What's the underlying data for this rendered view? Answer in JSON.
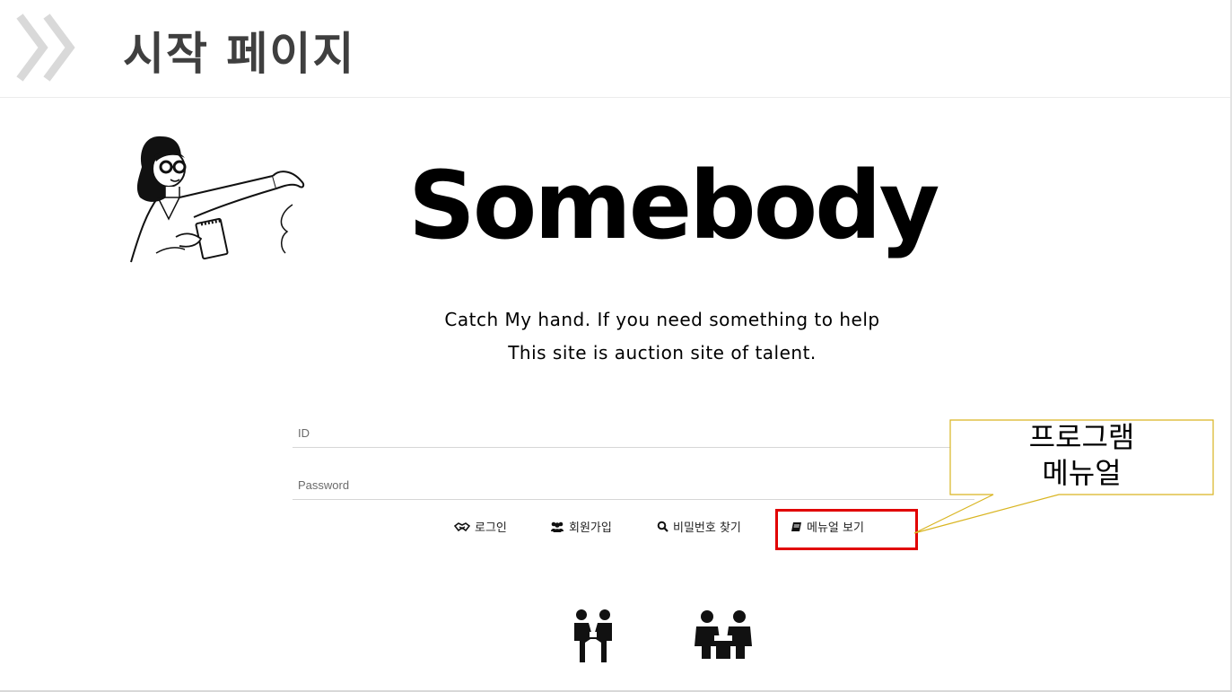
{
  "header": {
    "title": "시작 페이지",
    "chevron_icon": "double-chevron-right-icon"
  },
  "brand": {
    "logo_text": "Somebody",
    "tagline_line1": "Catch My hand. If you need something to help",
    "tagline_line2": "This site is auction site of talent."
  },
  "form": {
    "id_placeholder": "ID",
    "id_value": "",
    "password_placeholder": "Password",
    "password_value": ""
  },
  "links": [
    {
      "label": "로그인",
      "icon": "handshake-icon"
    },
    {
      "label": "회원가입",
      "icon": "users-icon"
    },
    {
      "label": "비밀번호 찾기",
      "icon": "search-icon"
    },
    {
      "label": "메뉴얼 보기",
      "icon": "book-icon"
    }
  ],
  "annotation": {
    "callout_line1": "프로그램",
    "callout_line2": "메뉴얼",
    "highlight_color": "#e10000",
    "callout_border_color": "#d9b521"
  },
  "footer_icons": [
    "business-handshake-icon",
    "meeting-table-icon"
  ]
}
